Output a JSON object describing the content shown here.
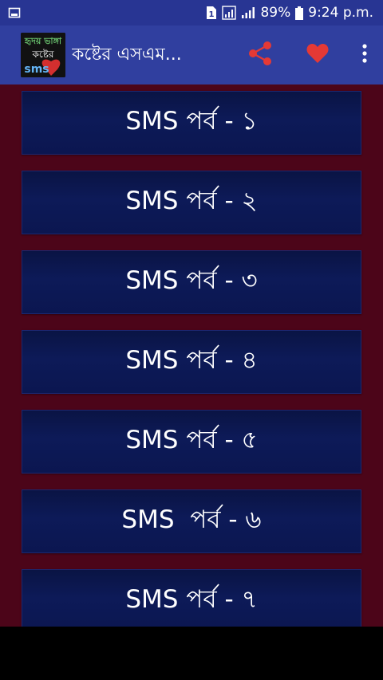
{
  "status_bar": {
    "battery": "89%",
    "time": "9:24 p.m.",
    "sim_label": "1"
  },
  "app_bar": {
    "logo_line1": "হৃদয় ভাঙ্গা",
    "logo_line2": "কষ্টের",
    "logo_line3": "sms",
    "title": "কষ্টের এসএম...",
    "share_color": "#e53935",
    "heart_color": "#e53935"
  },
  "items": [
    {
      "label": "SMS পর্ব - ১"
    },
    {
      "label": "SMS পর্ব - ২"
    },
    {
      "label": "SMS পর্ব - ৩"
    },
    {
      "label": "SMS পর্ব - ৪"
    },
    {
      "label": "SMS পর্ব - ৫"
    },
    {
      "label": "SMS  পর্ব - ৬"
    },
    {
      "label": "SMS পর্ব - ৭"
    }
  ]
}
